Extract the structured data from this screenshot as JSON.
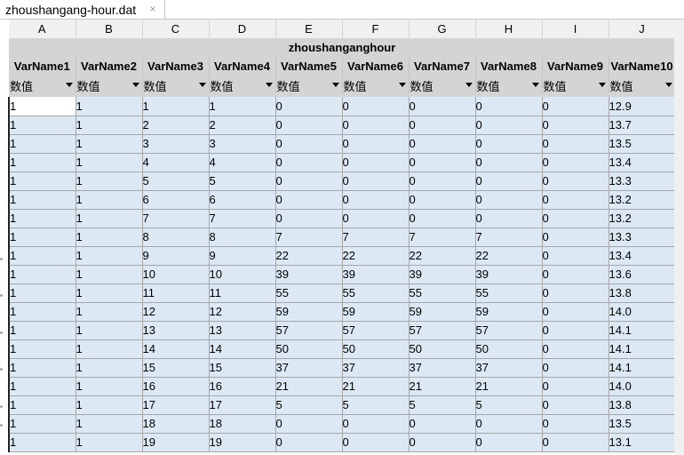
{
  "tab": {
    "title": "zhoushangang-hour.dat",
    "close_glyph": "×"
  },
  "sheet": {
    "column_letters": [
      "A",
      "B",
      "C",
      "D",
      "E",
      "F",
      "G",
      "H",
      "I",
      "J"
    ],
    "title": "zhoushanganghour",
    "var_names": [
      "VarName1",
      "VarName2",
      "VarName3",
      "VarName4",
      "VarName5",
      "VarName6",
      "VarName7",
      "VarName8",
      "VarName9",
      "VarName10"
    ],
    "type_label": "数值",
    "rows": [
      [
        "1",
        "1",
        "1",
        "1",
        "0",
        "0",
        "0",
        "0",
        "0",
        "12.9"
      ],
      [
        "1",
        "1",
        "2",
        "2",
        "0",
        "0",
        "0",
        "0",
        "0",
        "13.7"
      ],
      [
        "1",
        "1",
        "3",
        "3",
        "0",
        "0",
        "0",
        "0",
        "0",
        "13.5"
      ],
      [
        "1",
        "1",
        "4",
        "4",
        "0",
        "0",
        "0",
        "0",
        "0",
        "13.4"
      ],
      [
        "1",
        "1",
        "5",
        "5",
        "0",
        "0",
        "0",
        "0",
        "0",
        "13.3"
      ],
      [
        "1",
        "1",
        "6",
        "6",
        "0",
        "0",
        "0",
        "0",
        "0",
        "13.2"
      ],
      [
        "1",
        "1",
        "7",
        "7",
        "0",
        "0",
        "0",
        "0",
        "0",
        "13.2"
      ],
      [
        "1",
        "1",
        "8",
        "8",
        "7",
        "7",
        "7",
        "7",
        "0",
        "13.3"
      ],
      [
        "1",
        "1",
        "9",
        "9",
        "22",
        "22",
        "22",
        "22",
        "0",
        "13.4"
      ],
      [
        "1",
        "1",
        "10",
        "10",
        "39",
        "39",
        "39",
        "39",
        "0",
        "13.6"
      ],
      [
        "1",
        "1",
        "11",
        "11",
        "55",
        "55",
        "55",
        "55",
        "0",
        "13.8"
      ],
      [
        "1",
        "1",
        "12",
        "12",
        "59",
        "59",
        "59",
        "59",
        "0",
        "14.0"
      ],
      [
        "1",
        "1",
        "13",
        "13",
        "57",
        "57",
        "57",
        "57",
        "0",
        "14.1"
      ],
      [
        "1",
        "1",
        "14",
        "14",
        "50",
        "50",
        "50",
        "50",
        "0",
        "14.1"
      ],
      [
        "1",
        "1",
        "15",
        "15",
        "37",
        "37",
        "37",
        "37",
        "0",
        "14.1"
      ],
      [
        "1",
        "1",
        "16",
        "16",
        "21",
        "21",
        "21",
        "21",
        "0",
        "14.0"
      ],
      [
        "1",
        "1",
        "17",
        "17",
        "5",
        "5",
        "5",
        "5",
        "0",
        "13.8"
      ],
      [
        "1",
        "1",
        "18",
        "18",
        "0",
        "0",
        "0",
        "0",
        "0",
        "13.5"
      ],
      [
        "1",
        "1",
        "19",
        "19",
        "0",
        "0",
        "0",
        "0",
        "0",
        "13.1"
      ]
    ]
  },
  "colors": {
    "cell_fill": "#dce9f5",
    "header_fill": "#d4d4d4",
    "active_cell": "#ffffff"
  }
}
